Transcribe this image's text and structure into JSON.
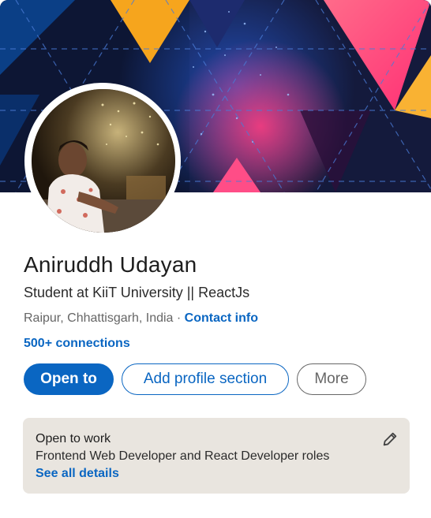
{
  "profile": {
    "name": "Aniruddh Udayan",
    "headline": "Student at KiiT University || ReactJs",
    "location": "Raipur, Chhattisgarh, India",
    "separator": " · ",
    "contact_info": "Contact info",
    "connections": "500+ connections"
  },
  "actions": {
    "open_to": "Open to",
    "add_profile_section": "Add profile section",
    "more": "More"
  },
  "open_to_work": {
    "title": "Open to work",
    "description": "Frontend Web Developer and React Developer roles",
    "see_all": "See all details",
    "edit_icon": "pencil-icon"
  },
  "colors": {
    "accent": "#0a66c2",
    "card_bg": "#e9e5df",
    "banner_bg": "#0b1330"
  }
}
